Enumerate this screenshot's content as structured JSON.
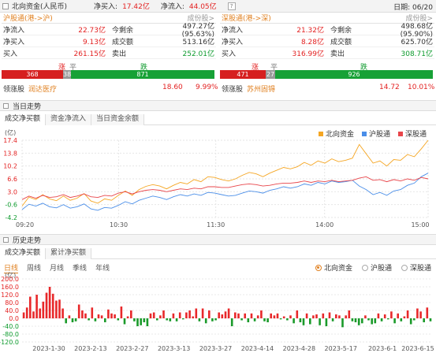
{
  "topbar": {
    "title": "北向资金(人民币)",
    "net_buy_label": "净买入:",
    "net_buy_value": "17.42亿",
    "net_inflow_label": "净流入:",
    "net_inflow_value": "44.05亿",
    "help": "?",
    "date": "日期: 06/20"
  },
  "sh": {
    "name": "沪股通(港->沪)",
    "more": "成份股>",
    "rows": [
      {
        "l1": "净流入",
        "v1": "22.73亿",
        "l2": "今剩余",
        "v2": "497.27亿(95.63%)",
        "v2green": false
      },
      {
        "l1": "净买入",
        "v1": "9.13亿",
        "l2": "成交额",
        "v2": "513.16亿",
        "v2green": false
      },
      {
        "l1": "买入",
        "v1": "261.15亿",
        "l2": "卖出",
        "v2": "252.01亿",
        "v2green": true
      }
    ],
    "up_label": "涨",
    "flat_label": "平",
    "down_label": "跌",
    "up": "368",
    "flat": "38",
    "down": "871",
    "leader_label": "领涨股",
    "leader_name": "润达医疗",
    "leader_price": "18.60",
    "leader_pct": "9.99%"
  },
  "sz": {
    "name": "深股通(港->深)",
    "more": "成份股>",
    "rows": [
      {
        "l1": "净流入",
        "v1": "21.32亿",
        "l2": "今剩余",
        "v2": "498.68亿(95.90%)",
        "v2green": false
      },
      {
        "l1": "净买入",
        "v1": "8.28亿",
        "l2": "成交额",
        "v2": "625.70亿",
        "v2green": false
      },
      {
        "l1": "买入",
        "v1": "316.99亿",
        "l2": "卖出",
        "v2": "308.71亿",
        "v2green": true
      }
    ],
    "up_label": "涨",
    "flat_label": "平",
    "down_label": "跌",
    "up": "471",
    "flat": "27",
    "down": "926",
    "leader_label": "领涨股",
    "leader_name": "苏州固锝",
    "leader_price": "14.72",
    "leader_pct": "10.01%"
  },
  "intraday": {
    "section_title": "当日走势",
    "tabs": [
      "成交净买额",
      "资金净流入",
      "当日资金余额"
    ],
    "legend": [
      "北向资金",
      "沪股通",
      "深股通"
    ],
    "colors": {
      "north": "#f5a623",
      "sh": "#4a8ee8",
      "sz": "#e8454a"
    }
  },
  "history": {
    "section_title": "历史走势",
    "tabs": [
      "成交净买额",
      "累计净买额"
    ],
    "subtabs": [
      "日线",
      "周线",
      "月线",
      "季线",
      "年线"
    ],
    "radios": [
      "北向资金",
      "沪股通",
      "深股通"
    ]
  },
  "chart_data": [
    {
      "type": "line",
      "unit_label": "(亿)",
      "x_ticks": [
        "09:20",
        "10:30",
        "11:30",
        "14:00",
        "15:00"
      ],
      "y_ticks": [
        17.4,
        13.8,
        10.2,
        6.6,
        3.0,
        -0.6,
        -4.2
      ],
      "ylim": [
        -4.2,
        17.4
      ],
      "series": [
        {
          "name": "北向资金",
          "color": "#f5a623",
          "values": [
            -1,
            1.5,
            0.8,
            2.2,
            1,
            0.5,
            1.8,
            0.6,
            1.2,
            2.5,
            0.4,
            -0.2,
            1,
            0.6,
            2,
            3.2,
            2,
            3.6,
            4.5,
            5,
            4.6,
            3.8,
            4.8,
            5.6,
            5.2,
            6.4,
            5.8,
            7.2,
            7,
            6.4,
            6,
            6.6,
            7.6,
            8.4,
            8,
            7.2,
            8.2,
            9,
            9.8,
            9.4,
            10,
            11.2,
            10.4,
            11.6,
            11,
            12.2,
            11.4,
            11.8,
            12.4,
            16.2,
            13.6,
            11,
            11.6,
            10.2,
            12,
            11.8,
            13.4,
            12.8,
            15,
            17.4
          ]
        },
        {
          "name": "沪股通",
          "color": "#4a8ee8",
          "values": [
            -2,
            -0.5,
            -1,
            -0.2,
            -1.2,
            -1.5,
            -0.6,
            -1.6,
            -1.2,
            -0.4,
            -1.8,
            -2.2,
            -1.4,
            -1.6,
            -0.8,
            0.2,
            -0.4,
            0.6,
            1.2,
            1.8,
            1.4,
            0.8,
            1.6,
            2.2,
            1.8,
            2.4,
            2,
            2.8,
            2.6,
            2.2,
            1.8,
            2,
            2.6,
            3.2,
            3,
            2.6,
            3.4,
            3.8,
            4.4,
            4,
            4.4,
            5.2,
            4.8,
            5.6,
            5.2,
            6,
            5.6,
            5.8,
            6.2,
            4.6,
            3.6,
            2.2,
            2.8,
            2,
            3.2,
            3.6,
            4.8,
            5.4,
            7.2,
            8.2
          ]
        },
        {
          "name": "深股通",
          "color": "#e8454a",
          "values": [
            0.8,
            1.8,
            1.2,
            2,
            1.4,
            1.6,
            2.2,
            1.4,
            1.8,
            2.4,
            1.6,
            1.4,
            2,
            1.8,
            2.6,
            3,
            2.4,
            3,
            3.4,
            3.6,
            3.4,
            3,
            3.4,
            3.8,
            3.6,
            4,
            3.8,
            4.4,
            4.4,
            4.2,
            4.2,
            4.6,
            5,
            5.2,
            5,
            4.6,
            4.8,
            5.2,
            5.4,
            5.4,
            5.6,
            6,
            5.6,
            6,
            5.8,
            6.2,
            5.8,
            6,
            6.2,
            6.8,
            7.2,
            6.2,
            6.4,
            5.8,
            6.4,
            6,
            6.6,
            6.2,
            7,
            6.6
          ]
        }
      ]
    },
    {
      "type": "bar",
      "unit_label": "(亿)",
      "y_ticks": [
        200.0,
        160.0,
        120.0,
        80.0,
        40.0,
        0.0,
        -40.0,
        -80.0,
        -120.0
      ],
      "ylim": [
        -120,
        200
      ],
      "x_ticks": [
        "2023-1-30",
        "2023-2-13",
        "2023-2-27",
        "2023-3-13",
        "2023-3-27",
        "2023-4-14",
        "2023-4-28",
        "2023-5-17",
        "2023-6-1",
        "2023-6-15"
      ],
      "colors": {
        "pos": "#e8282a",
        "neg": "#1a9a2a"
      },
      "values": [
        30,
        55,
        110,
        35,
        120,
        50,
        85,
        130,
        160,
        125,
        90,
        95,
        50,
        -25,
        15,
        -20,
        -15,
        70,
        40,
        25,
        -10,
        55,
        -15,
        20,
        15,
        -20,
        45,
        25,
        20,
        -10,
        60,
        -30,
        10,
        40,
        -15,
        -40,
        -35,
        -20,
        -40,
        25,
        30,
        -10,
        15,
        40,
        -10,
        -15,
        25,
        -15,
        30,
        -5,
        30,
        40,
        10,
        50,
        -15,
        50,
        -25,
        40,
        -15,
        -10,
        30,
        20,
        35,
        50,
        -40,
        30,
        25,
        -10,
        25,
        -20,
        25,
        -15,
        15,
        40,
        -15,
        -20,
        25,
        15,
        25,
        -5,
        10,
        -10,
        15,
        -25,
        40,
        -20,
        -35,
        25,
        -30,
        15,
        20,
        -35,
        25,
        -40,
        30,
        -15,
        20,
        15,
        -45,
        15,
        40,
        -15,
        -20,
        -35,
        -25,
        15,
        -10,
        -30,
        -25,
        25,
        -15,
        20,
        -5,
        35,
        -25,
        25,
        -15,
        10,
        40,
        -30,
        -10,
        50,
        35,
        -20,
        55,
        -15
      ]
    }
  ]
}
